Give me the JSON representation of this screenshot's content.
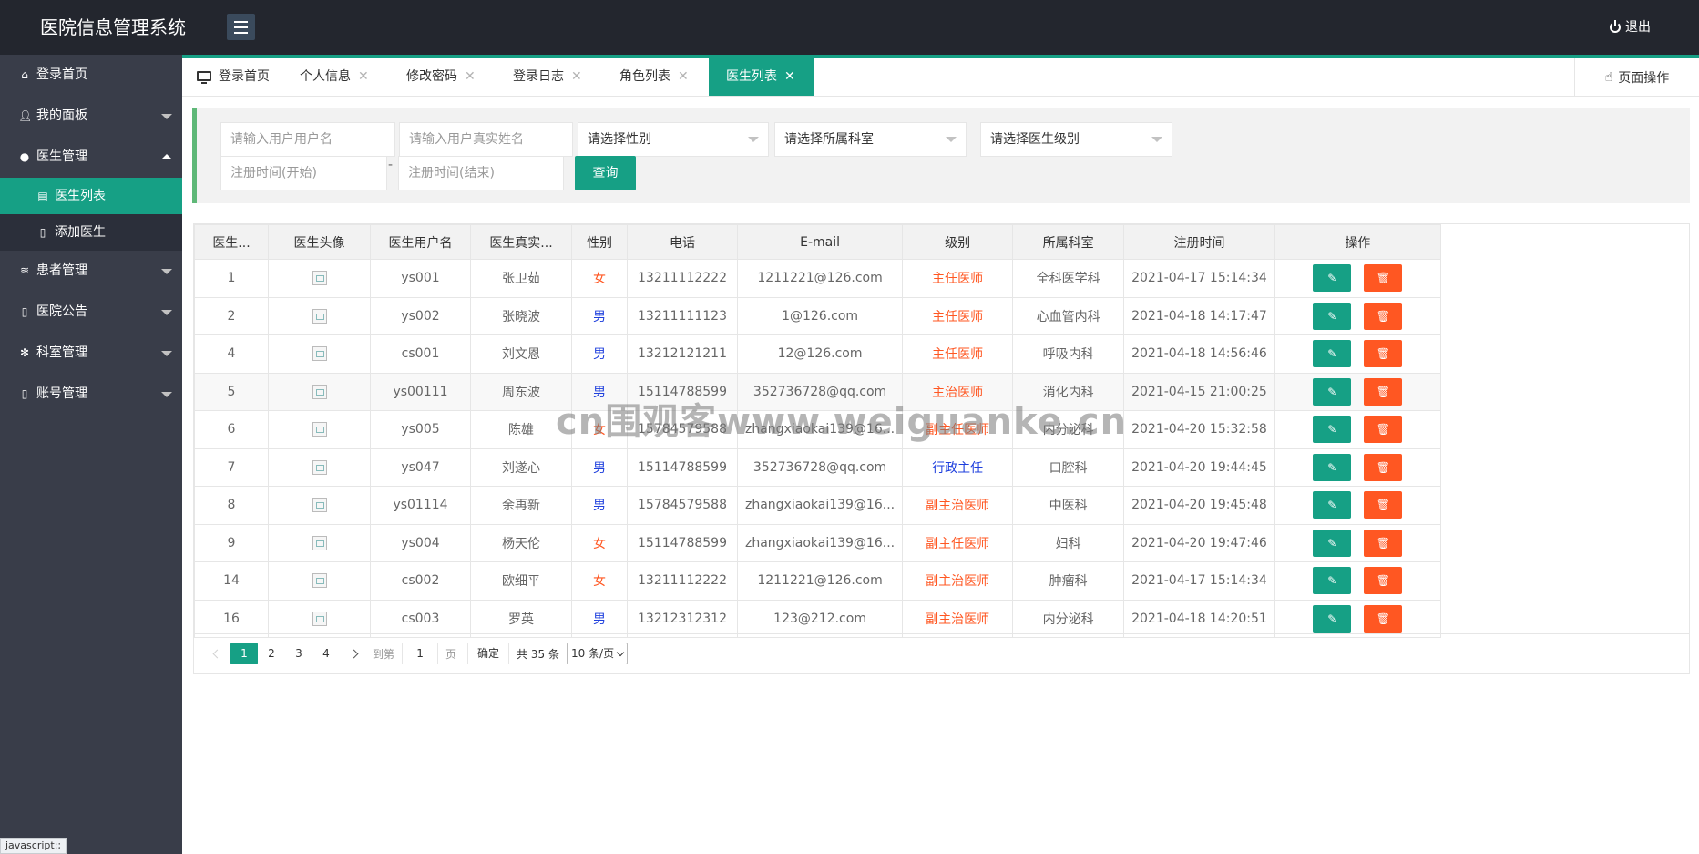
{
  "app": {
    "title": "医院信息管理系统",
    "logout_label": "退出"
  },
  "sidebar": {
    "items": [
      {
        "label": "登录首页",
        "icon": "home-icon"
      },
      {
        "label": "我的面板",
        "icon": "user-icon"
      },
      {
        "label": "医生管理",
        "icon": "doctor-icon",
        "expanded": true,
        "children": [
          {
            "label": "医生列表",
            "icon": "list-icon",
            "active": true
          },
          {
            "label": "添加医生",
            "icon": "form-icon"
          }
        ]
      },
      {
        "label": "患者管理",
        "icon": "layers-icon"
      },
      {
        "label": "医院公告",
        "icon": "notice-icon"
      },
      {
        "label": "科室管理",
        "icon": "snowflake-icon"
      },
      {
        "label": "账号管理",
        "icon": "account-icon"
      }
    ]
  },
  "status_bar": "javascript:;",
  "tabs": [
    {
      "label": "登录首页",
      "closable": false
    },
    {
      "label": "个人信息",
      "closable": true
    },
    {
      "label": "修改密码",
      "closable": true
    },
    {
      "label": "登录日志",
      "closable": true
    },
    {
      "label": "角色列表",
      "closable": true
    },
    {
      "label": "医生列表",
      "closable": true,
      "active": true
    }
  ],
  "page_ops_label": "页面操作",
  "search": {
    "username_placeholder": "请输入用户用户名",
    "realname_placeholder": "请输入用户真实姓名",
    "gender_select": "请选择性别",
    "department_select": "请选择所属科室",
    "level_select": "请选择医生级别",
    "start_placeholder": "注册时间(开始)",
    "separator": "-",
    "end_placeholder": "注册时间(结束)",
    "query_label": "查询"
  },
  "table": {
    "headers": [
      "医生...",
      "医生头像",
      "医生用户名",
      "医生真实...",
      "性别",
      "电话",
      "E-mail",
      "级别",
      "所属科室",
      "注册时间",
      "操作"
    ],
    "rows": [
      {
        "id": "1",
        "username": "ys001",
        "name": "张卫茹",
        "sex": "女",
        "phone": "13211112222",
        "email": "1211221@126.com",
        "level": "主任医师",
        "dept": "全科医学科",
        "time": "2021-04-17 15:14:34"
      },
      {
        "id": "2",
        "username": "ys002",
        "name": "张晓波",
        "sex": "男",
        "phone": "13211111123",
        "email": "1@126.com",
        "level": "主任医师",
        "dept": "心血管内科",
        "time": "2021-04-18 14:17:47"
      },
      {
        "id": "4",
        "username": "cs001",
        "name": "刘文恩",
        "sex": "男",
        "phone": "13212121211",
        "email": "12@126.com",
        "level": "主任医师",
        "dept": "呼吸内科",
        "time": "2021-04-18 14:56:46"
      },
      {
        "id": "5",
        "username": "ys00111",
        "name": "周东波",
        "sex": "男",
        "phone": "15114788599",
        "email": "352736728@qq.com",
        "level": "主治医师",
        "dept": "消化内科",
        "time": "2021-04-15 21:00:25"
      },
      {
        "id": "6",
        "username": "ys005",
        "name": "陈雄",
        "sex": "女",
        "phone": "15784579588",
        "email": "zhangxiaokai139@16...",
        "level": "副主任医师",
        "dept": "内分泌科",
        "time": "2021-04-20 15:32:58"
      },
      {
        "id": "7",
        "username": "ys047",
        "name": "刘遂心",
        "sex": "男",
        "phone": "15114788599",
        "email": "352736728@qq.com",
        "level": "行政主任",
        "dept": "口腔科",
        "time": "2021-04-20 19:44:45"
      },
      {
        "id": "8",
        "username": "ys01114",
        "name": "余再新",
        "sex": "男",
        "phone": "15784579588",
        "email": "zhangxiaokai139@16...",
        "level": "副主治医师",
        "dept": "中医科",
        "time": "2021-04-20 19:45:48"
      },
      {
        "id": "9",
        "username": "ys004",
        "name": "杨天伦",
        "sex": "女",
        "phone": "15114788599",
        "email": "zhangxiaokai139@16...",
        "level": "副主任医师",
        "dept": "妇科",
        "time": "2021-04-20 19:47:46"
      },
      {
        "id": "14",
        "username": "cs002",
        "name": "欧细平",
        "sex": "女",
        "phone": "13211112222",
        "email": "1211221@126.com",
        "level": "副主治医师",
        "dept": "肿瘤科",
        "time": "2021-04-17 15:14:34"
      },
      {
        "id": "16",
        "username": "cs003",
        "name": "罗英",
        "sex": "男",
        "phone": "13212312312",
        "email": "123@212.com",
        "level": "副主治医师",
        "dept": "内分泌科",
        "time": "2021-04-18 14:20:51"
      }
    ]
  },
  "pagination": {
    "pages": [
      "1",
      "2",
      "3",
      "4"
    ],
    "current": "1",
    "goto_label": "到第",
    "goto_value": "1",
    "page_unit": "页",
    "confirm_label": "确定",
    "total": "共 35 条",
    "page_size": "10 条/页"
  },
  "watermark": "cn围观客www.weiguanke.cn",
  "colors": {
    "accent": "#16a085",
    "danger": "#ff5722",
    "male": "#1e3fdd",
    "sidebar": "#393d49",
    "topbar": "#23262e"
  }
}
